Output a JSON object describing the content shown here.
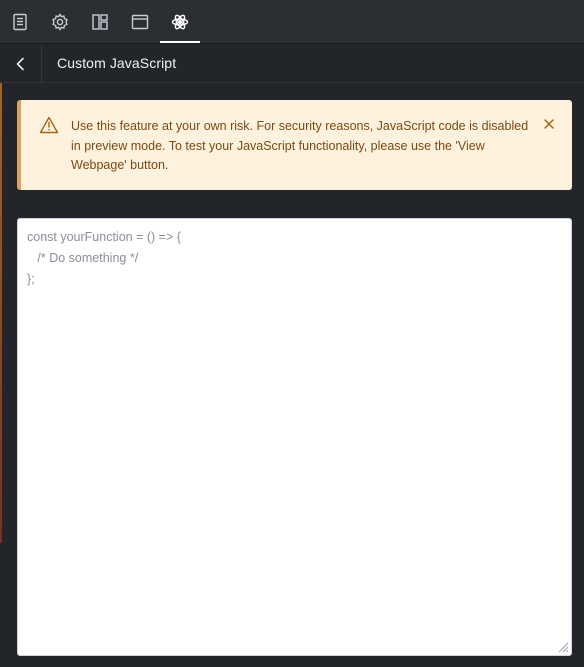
{
  "tabs": [
    {
      "icon": "page-icon",
      "active": false
    },
    {
      "icon": "gear-icon",
      "active": false
    },
    {
      "icon": "layout-icon",
      "active": false
    },
    {
      "icon": "browser-window-icon",
      "active": false
    },
    {
      "icon": "atom-icon",
      "active": true
    }
  ],
  "header": {
    "title": "Custom JavaScript"
  },
  "alert": {
    "message": "Use this feature at your own risk. For security reasons, JavaScript code is disabled in preview mode. To test your JavaScript functionality, please use the 'View Webpage' button.",
    "background": "#fef2df",
    "accent": "#e0a05a",
    "text_color": "#7a4a12"
  },
  "editor": {
    "lines": [
      "const yourFunction = () => {",
      "   /* Do something */",
      "};"
    ]
  }
}
